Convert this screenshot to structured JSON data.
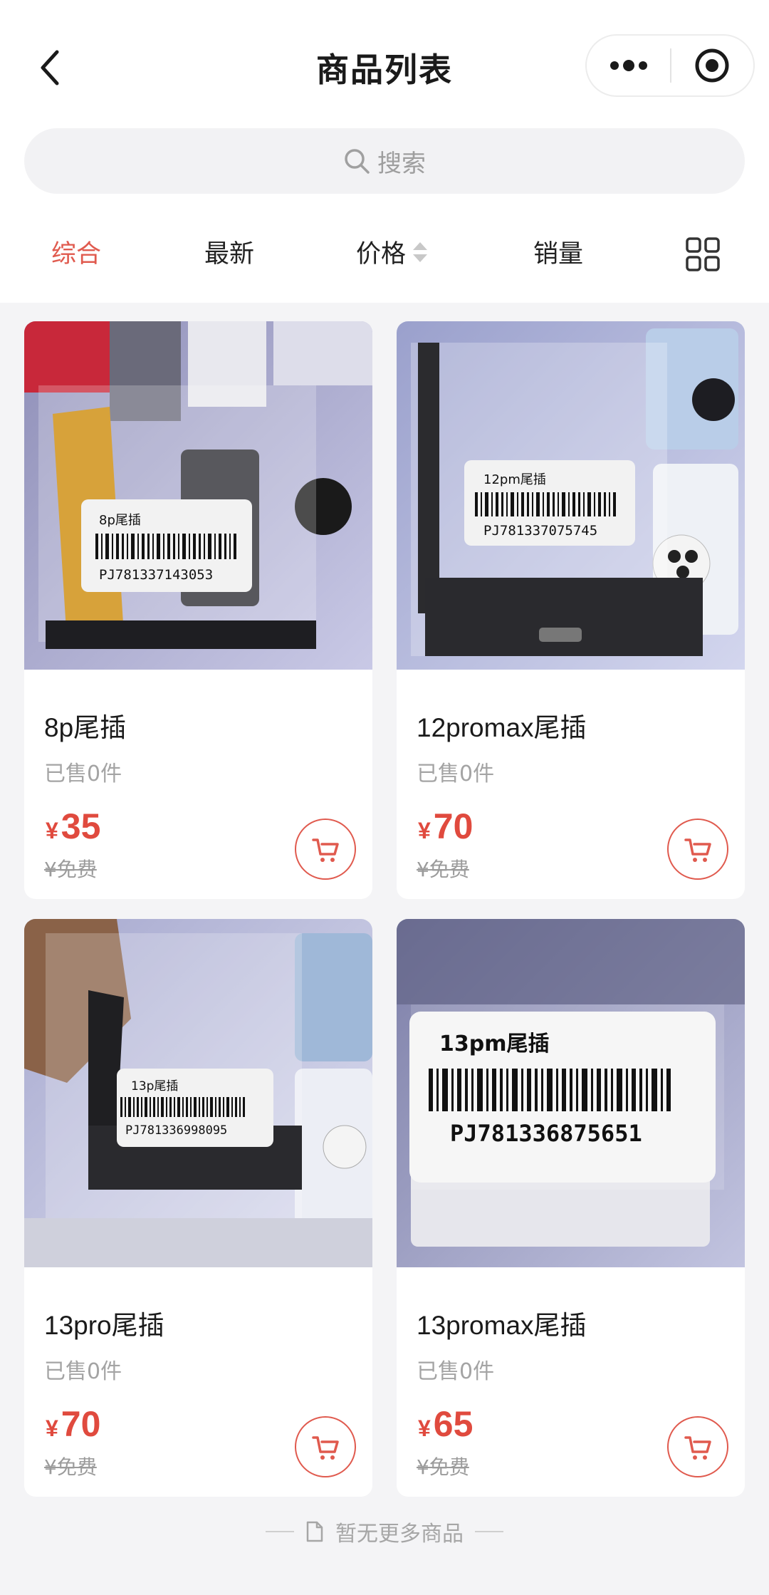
{
  "header": {
    "title": "商品列表",
    "back_icon": "chevron-left-icon",
    "more_icon": "more-dots-icon",
    "close_icon": "record-close-icon"
  },
  "search": {
    "placeholder": "搜索"
  },
  "sort": {
    "tabs": [
      {
        "label": "综合",
        "active": true
      },
      {
        "label": "最新",
        "active": false
      },
      {
        "label": "价格",
        "active": false,
        "sortable": true
      },
      {
        "label": "销量",
        "active": false
      }
    ],
    "layout_icon": "grid-layout-icon"
  },
  "products": [
    {
      "name": "8p尾插",
      "sold": "已售0件",
      "currency": "¥",
      "price": "35",
      "original_price": "¥免费",
      "photo_label": "8p尾插",
      "photo_code": "PJ781337143053"
    },
    {
      "name": "12promax尾插",
      "sold": "已售0件",
      "currency": "¥",
      "price": "70",
      "original_price": "¥免费",
      "photo_label": "12pm尾插",
      "photo_code": "PJ781337075745"
    },
    {
      "name": "13pro尾插",
      "sold": "已售0件",
      "currency": "¥",
      "price": "70",
      "original_price": "¥免费",
      "photo_label": "13p尾插",
      "photo_code": "PJ781336998095"
    },
    {
      "name": "13promax尾插",
      "sold": "已售0件",
      "currency": "¥",
      "price": "65",
      "original_price": "¥免费",
      "photo_label": "13pm尾插",
      "photo_code": "PJ781336875651"
    }
  ],
  "footer": {
    "text": "暂无更多商品"
  },
  "colors": {
    "accent": "#e05a4e",
    "price": "#e04a3e",
    "background": "#f4f4f6"
  }
}
